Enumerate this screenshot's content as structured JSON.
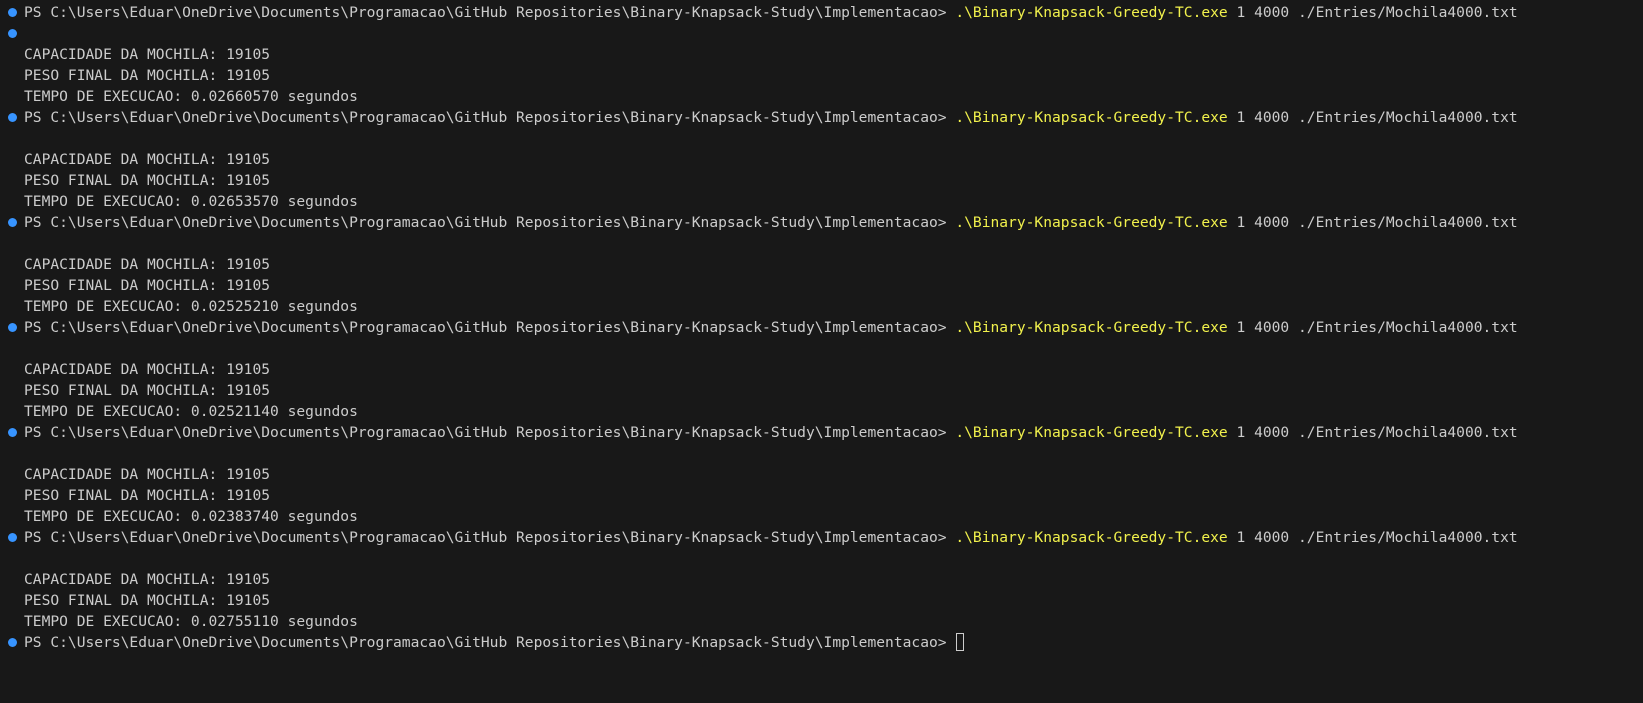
{
  "colors": {
    "background": "#181818",
    "text": "#cccccc",
    "command": "#f1f14c",
    "decoration": "#3794ff"
  },
  "terminal": {
    "prompt": "PS C:\\Users\\Eduar\\OneDrive\\Documents\\Programacao\\GitHub Repositories\\Binary-Knapsack-Study\\Implementacao> ",
    "command": ".\\Binary-Knapsack-Greedy-TC.exe",
    "args": " 1 4000 ./Entries/Mochila4000.txt",
    "runs": [
      {
        "capacidade": "CAPACIDADE DA MOCHILA: 19105",
        "peso": "PESO FINAL DA MOCHILA: 19105",
        "tempo": "TEMPO DE EXECUCAO: 0.02660570 segundos"
      },
      {
        "capacidade": "CAPACIDADE DA MOCHILA: 19105",
        "peso": "PESO FINAL DA MOCHILA: 19105",
        "tempo": "TEMPO DE EXECUCAO: 0.02653570 segundos"
      },
      {
        "capacidade": "CAPACIDADE DA MOCHILA: 19105",
        "peso": "PESO FINAL DA MOCHILA: 19105",
        "tempo": "TEMPO DE EXECUCAO: 0.02525210 segundos"
      },
      {
        "capacidade": "CAPACIDADE DA MOCHILA: 19105",
        "peso": "PESO FINAL DA MOCHILA: 19105",
        "tempo": "TEMPO DE EXECUCAO: 0.02521140 segundos"
      },
      {
        "capacidade": "CAPACIDADE DA MOCHILA: 19105",
        "peso": "PESO FINAL DA MOCHILA: 19105",
        "tempo": "TEMPO DE EXECUCAO: 0.02383740 segundos"
      },
      {
        "capacidade": "CAPACIDADE DA MOCHILA: 19105",
        "peso": "PESO FINAL DA MOCHILA: 19105",
        "tempo": "TEMPO DE EXECUCAO: 0.02755110 segundos"
      }
    ]
  }
}
